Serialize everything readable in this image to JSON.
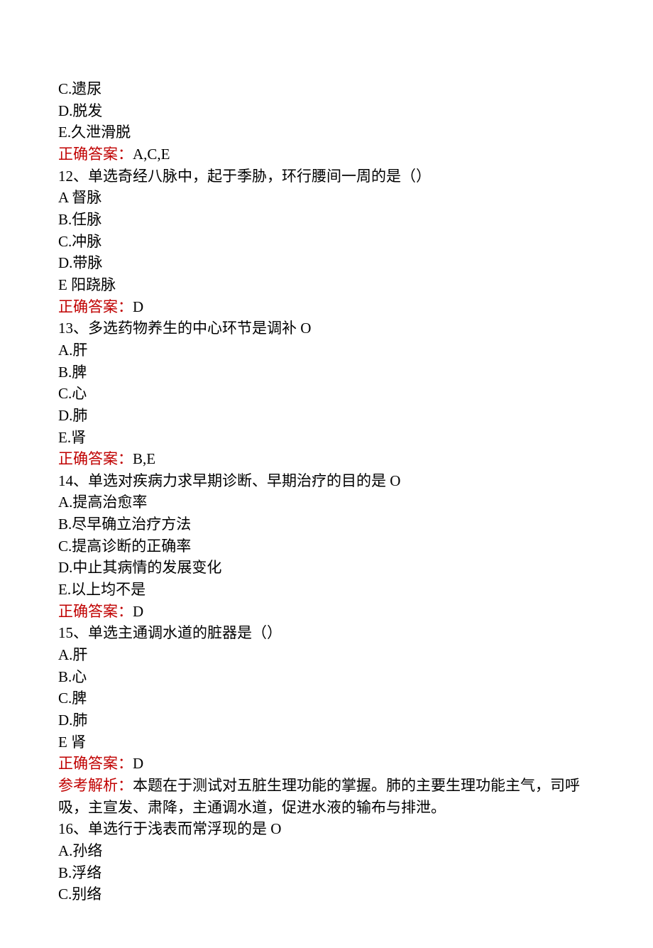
{
  "q11": {
    "optC": "C.遗尿",
    "optD": "D.脱发",
    "optE": "E.久泄滑脱",
    "answer_label": "正确答案：",
    "answer_value": "A,C,E"
  },
  "q12": {
    "stem": "12、单选奇经八脉中，起于季胁，环行腰间一周的是（）",
    "optA": "A 督脉",
    "optB": "B.任脉",
    "optC": "C.冲脉",
    "optD": "D.带脉",
    "optE": "E 阳跷脉",
    "answer_label": "正确答案：",
    "answer_value": "D"
  },
  "q13": {
    "stem": "13、多选药物养生的中心环节是调补 O",
    "optA": "A.肝",
    "optB": "B.脾",
    "optC": "C.心",
    "optD": "D.肺",
    "optE": "E.肾",
    "answer_label": "正确答案：",
    "answer_value": "B,E"
  },
  "q14": {
    "stem": "14、单选对疾病力求早期诊断、早期治疗的目的是 O",
    "optA": "A.提高治愈率",
    "optB": "B.尽早确立治疗方法",
    "optC": "C.提高诊断的正确率",
    "optD": "D.中止其病情的发展变化",
    "optE": "E.以上均不是",
    "answer_label": "正确答案：",
    "answer_value": "D"
  },
  "q15": {
    "stem": "15、单选主通调水道的脏器是（）",
    "optA": "A.肝",
    "optB": "B.心",
    "optC": "C.脾",
    "optD": "D.肺",
    "optE": "E 肾",
    "answer_label": "正确答案：",
    "answer_value": "D",
    "expl_label": "参考解析：",
    "expl_text": "本题在于测试对五脏生理功能的掌握。肺的主要生理功能主气，司呼吸，主宣发、肃降，主通调水道，促进水液的输布与排泄。"
  },
  "q16": {
    "stem": "16、单选行于浅表而常浮现的是 O",
    "optA": "A.孙络",
    "optB": "B.浮络",
    "optC": "C.别络"
  }
}
